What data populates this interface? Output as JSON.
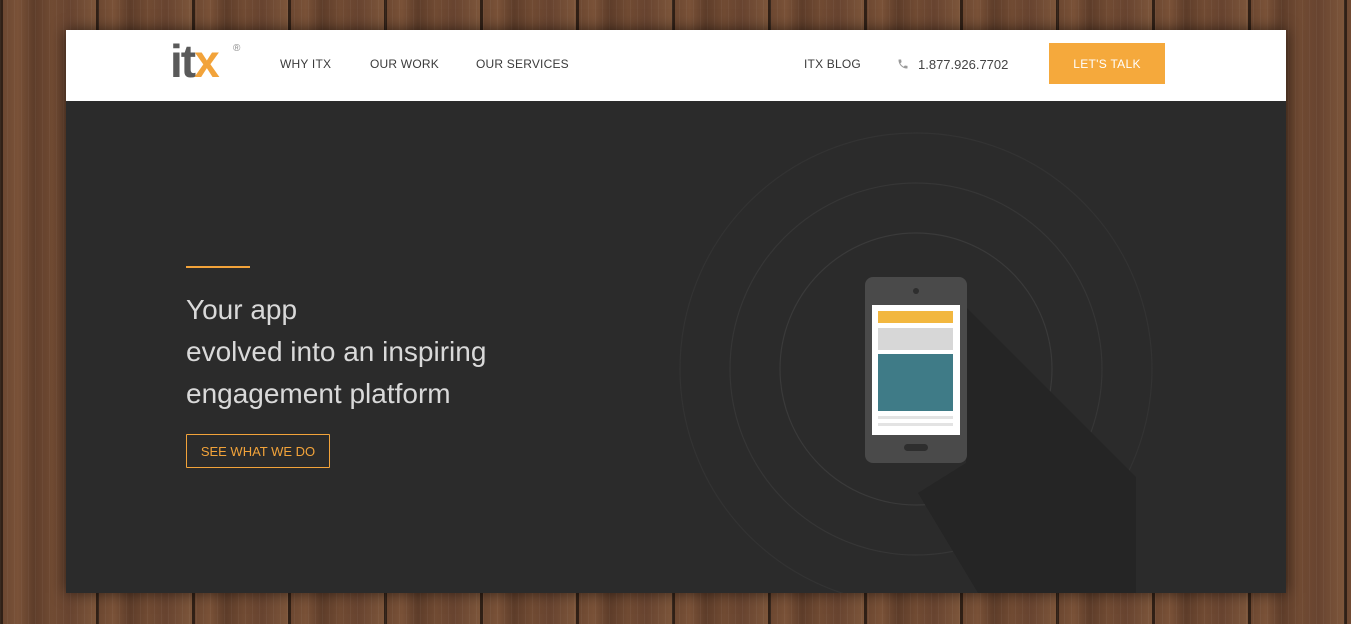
{
  "brand": {
    "logo_main": "it",
    "logo_accent": "x",
    "logo_mark": "®",
    "accent_color": "#f2a33a",
    "hero_bg": "#2b2b2b"
  },
  "nav": {
    "left": [
      {
        "label": "WHY ITX"
      },
      {
        "label": "OUR WORK"
      },
      {
        "label": "OUR SERVICES"
      }
    ],
    "blog": "ITX BLOG",
    "phone_icon": "phone-icon",
    "phone": "1.877.926.7702",
    "cta": "LET'S TALK"
  },
  "hero": {
    "lines": [
      "Your app",
      "evolved into an inspiring",
      "engagement platform"
    ],
    "button": "SEE WHAT WE DO",
    "illustration_icon": "smartphone-icon"
  }
}
